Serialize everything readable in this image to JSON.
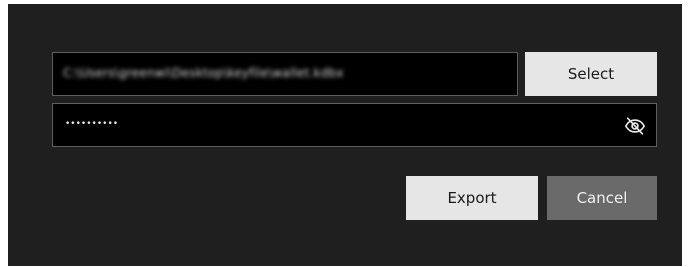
{
  "export_dialog": {
    "path_field": {
      "value": "C:\\Users\\greenwi\\Desktop\\keyfile\\wallet.kdbx"
    },
    "select_button": {
      "label": "Select"
    },
    "password_field": {
      "masked_value": "••••••••••",
      "toggle_icon": "eye-slash-icon"
    },
    "export_button": {
      "label": "Export"
    },
    "cancel_button": {
      "label": "Cancel"
    }
  },
  "colors": {
    "dialog_background": "#1f1f1f",
    "field_background": "#000000",
    "field_border": "#5e5e5e",
    "primary_button": "#e6e6e6",
    "secondary_button": "#6a6a6a"
  }
}
